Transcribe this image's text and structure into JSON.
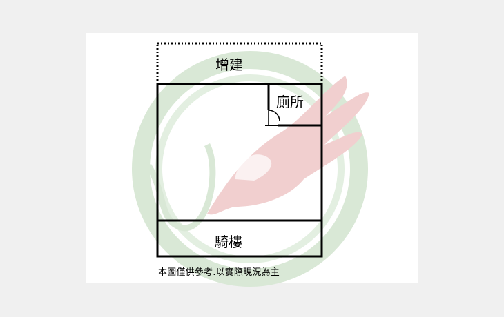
{
  "rooms": {
    "addition": "增建",
    "toilet": "廁所",
    "arcade": "騎樓"
  },
  "caption": "本圖僅供參考.以實際現況為主",
  "colors": {
    "background": "#f0f0f0",
    "paper": "#ffffff",
    "lines": "#000000",
    "watermark_green": "#d9e8d6",
    "watermark_red": "#f1cfcf"
  },
  "watermark": "hand-and-bird-logo"
}
